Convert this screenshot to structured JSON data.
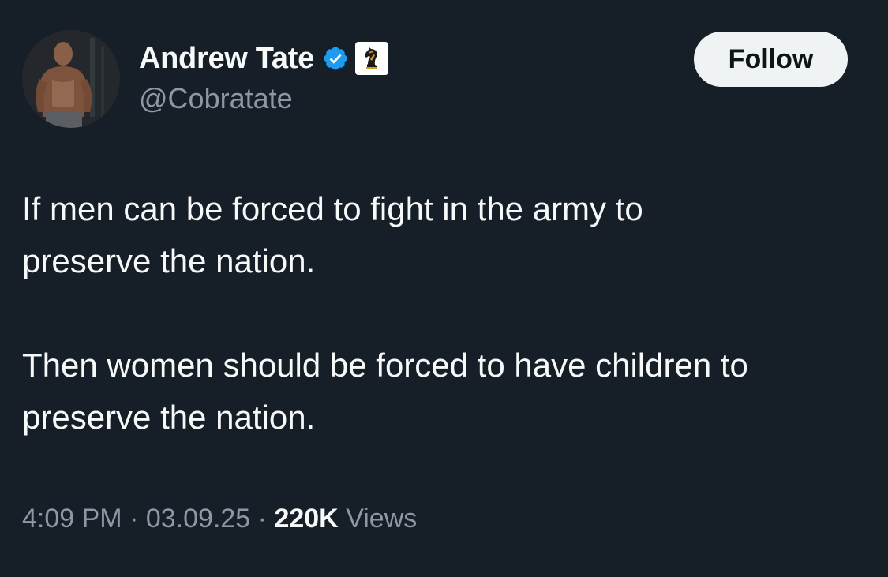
{
  "author": {
    "display_name": "Andrew Tate",
    "handle": "@Cobratate",
    "verified_badge_icon": "verified-badge-icon",
    "affiliate_badge_icon": "chess-knight-icon",
    "verified_color": "#1d9bf0"
  },
  "follow_button": {
    "label": "Follow"
  },
  "tweet": {
    "paragraph_1": "If men can be forced to fight in the army to\npreserve the nation.",
    "paragraph_2": "Then women should be forced to have children to\npreserve the nation."
  },
  "meta": {
    "time": "4:09 PM",
    "separator": "·",
    "date": "03.09.25",
    "views_count": "220K",
    "views_label": "Views"
  }
}
